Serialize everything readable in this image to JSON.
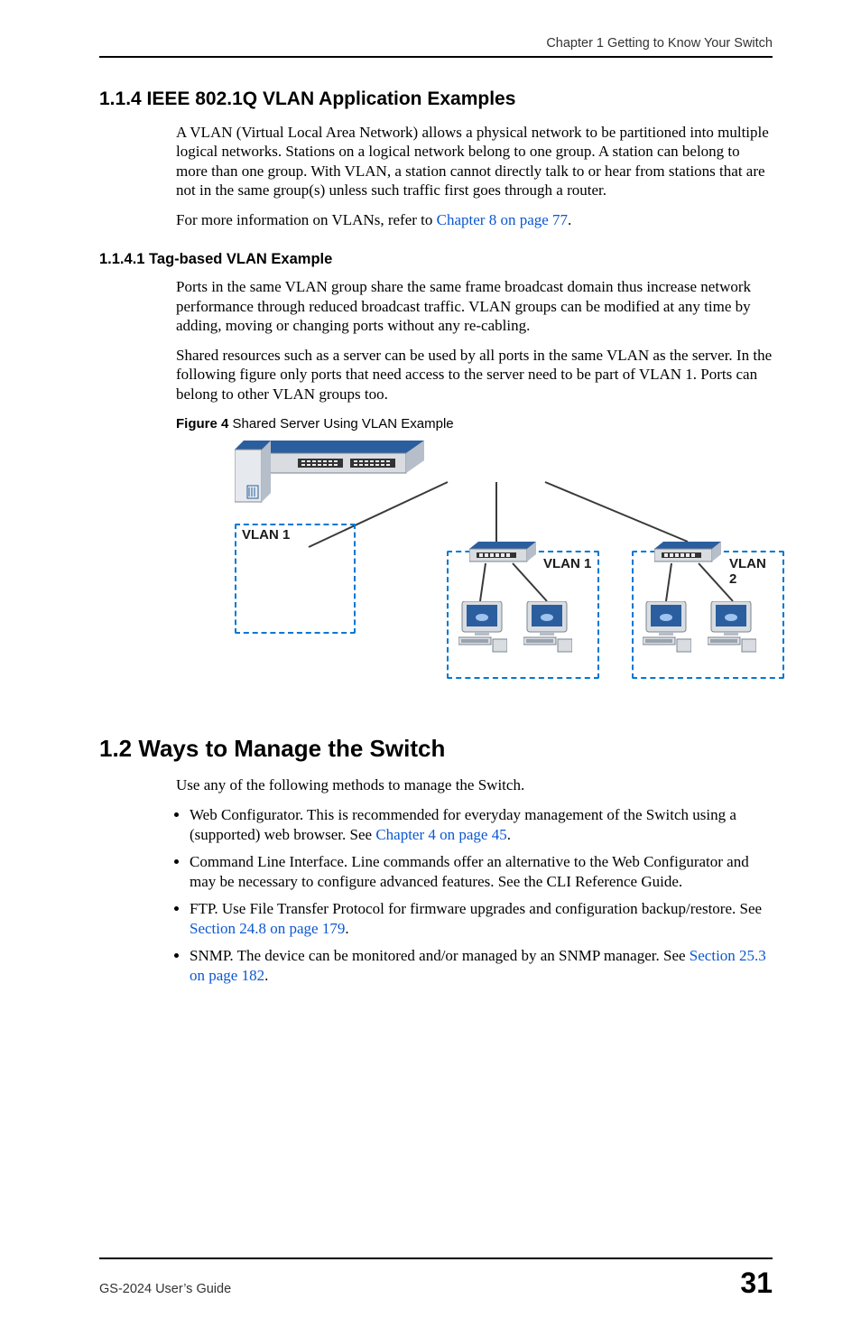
{
  "header": {
    "chapter": "Chapter 1 Getting to Know Your Switch"
  },
  "s114": {
    "heading": "1.1.4  IEEE 802.1Q VLAN Application Examples",
    "p1": "A VLAN (Virtual Local Area Network) allows a physical network to be partitioned into multiple logical networks. Stations on a logical network belong to one group. A station can belong to more than one group. With VLAN, a station cannot directly talk to or hear from stations that are not in the same group(s) unless such traffic first goes through a router.",
    "p2a": "For more information on VLANs, refer to ",
    "p2link": "Chapter 8 on page 77",
    "p2b": "."
  },
  "s1141": {
    "heading": "1.1.4.1  Tag-based VLAN Example",
    "p1": "Ports in the same VLAN group share the same frame broadcast domain thus increase network performance through reduced broadcast traffic. VLAN groups can be modified at any time by adding, moving or changing ports without any re-cabling.",
    "p2": "Shared resources such as a server can be used by all ports in the same VLAN as the server. In the following figure only ports that need access to the server need to be part of VLAN 1. Ports can belong to other VLAN groups too."
  },
  "figure": {
    "label": "Figure 4",
    "caption": "   Shared Server Using VLAN Example",
    "vlan_left": "VLAN 1",
    "vlan_mid": "VLAN 1",
    "vlan_right": "VLAN 2"
  },
  "s12": {
    "heading": "1.2  Ways to Manage the Switch",
    "intro": "Use any of the following methods to manage the Switch.",
    "items": [
      {
        "a": "Web Configurator. This is recommended for everyday management of the Switch using a (supported) web browser. See ",
        "link": "Chapter 4 on page 45",
        "b": "."
      },
      {
        "a": "Command Line Interface. Line commands offer an alternative to the Web Configurator and may be necessary to configure advanced features. See the CLI Reference Guide.",
        "link": "",
        "b": ""
      },
      {
        "a": "FTP. Use File Transfer Protocol for firmware upgrades and configuration backup/restore. See ",
        "link": "Section 24.8 on page 179",
        "b": "."
      },
      {
        "a": "SNMP. The device can be monitored and/or managed by an SNMP manager. See ",
        "link": "Section 25.3 on page 182",
        "b": "."
      }
    ]
  },
  "footer": {
    "guide": "GS-2024 User’s Guide",
    "page": "31"
  }
}
